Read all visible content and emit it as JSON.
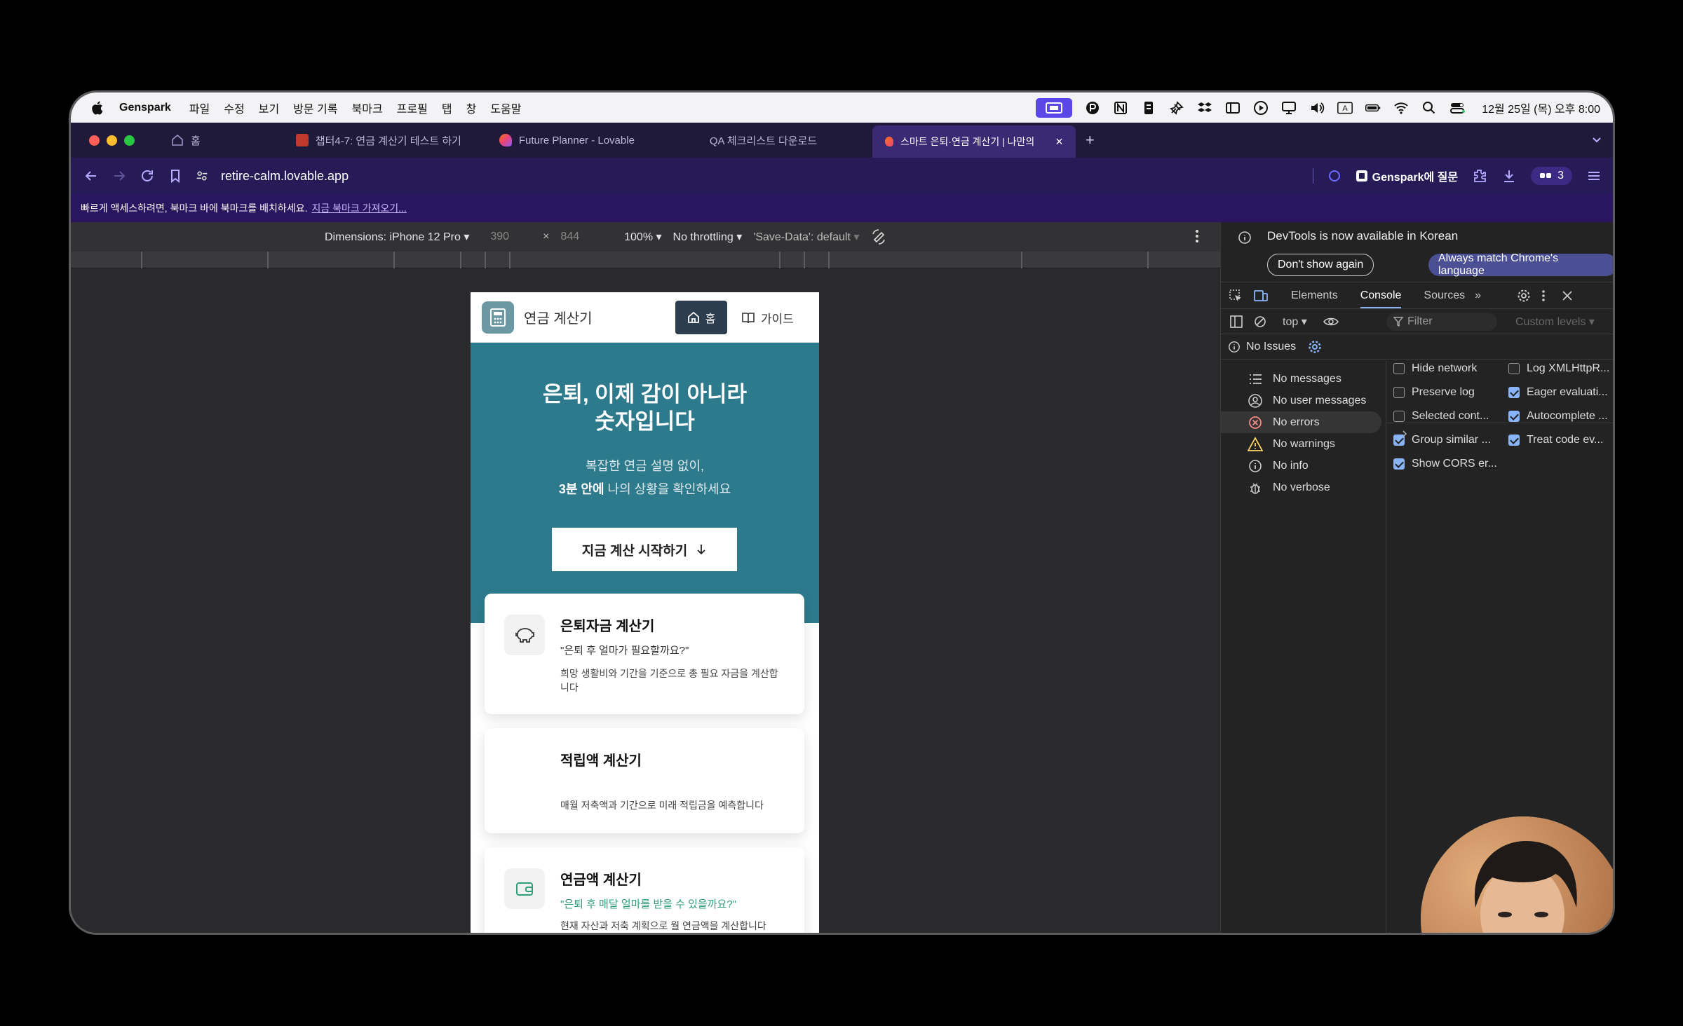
{
  "menubar": {
    "app_name": "Genspark",
    "items": [
      "파일",
      "수정",
      "보기",
      "방문 기록",
      "북마크",
      "프로필",
      "탭",
      "창",
      "도움말"
    ],
    "clock": "12월 25일 (목) 오후 8:00"
  },
  "tabs": {
    "home_label": "홈",
    "items": [
      {
        "label": "챕터4-7: 연금 계산기 테스트 하기",
        "favicon_color": "#c0392b"
      },
      {
        "label": "Future Planner - Lovable",
        "favicon_color": "#e9447a"
      },
      {
        "label": "QA 체크리스트 다운로드",
        "favicon_color": ""
      },
      {
        "label": "스마트 은퇴·연금 계산기 | 나만의",
        "favicon_color": "#e9447a"
      }
    ]
  },
  "address": {
    "url": "retire-calm.lovable.app",
    "genspark_ask": "Genspark에 질문",
    "ext_count": "3"
  },
  "bookmarks_bar": {
    "text": "빠르게 액세스하려면, 북마크 바에 북마크를 배치하세요.",
    "link": "지금 북마크 가져오기..."
  },
  "device_toolbar": {
    "dimensions": "Dimensions: iPhone 12 Pro",
    "width": "390",
    "height": "844",
    "zoom": "100%",
    "throttling": "No throttling",
    "save_data": "'Save-Data': default"
  },
  "app": {
    "title": "연금 계산기",
    "home_btn": "홈",
    "guide_btn": "가이드",
    "hero_title_1": "은퇴, 이제 감이 아니라",
    "hero_title_2": "숫자입니다",
    "hero_sub_1": "복잡한 연금 설명 없이,",
    "hero_sub_2_bold": "3분 안에",
    "hero_sub_2_rest": " 나의 상황을 확인하세요",
    "cta": "지금 계산 시작하기",
    "cards": [
      {
        "title": "은퇴자금 계산기",
        "question": "\"은퇴 후 얼마가 필요할까요?\"",
        "desc": "희망 생활비와 기간을 기준으로 총 필요 자금을 계산합니다"
      },
      {
        "title": "적립액 계산기",
        "question": "",
        "desc": "매월 저축액과 기간으로 미래 적립금을 예측합니다"
      },
      {
        "title": "연금액 계산기",
        "question": "\"은퇴 후 매달 얼마를 받을 수 있을까요?\"",
        "desc": "현재 자산과 저축 계획으로 월 연금액을 계산합니다"
      }
    ]
  },
  "devtools": {
    "notice": "DevTools is now available in Korean",
    "dont_show": "Don't show again",
    "match_lang": "Always match Chrome's language",
    "tabs": [
      "Elements",
      "Console",
      "Sources"
    ],
    "context": "top",
    "filter_placeholder": "Filter",
    "custom_levels": "Custom levels",
    "issues": "No Issues",
    "sidebar": [
      "No messages",
      "No user messages",
      "No errors",
      "No warnings",
      "No info",
      "No verbose"
    ],
    "options_left": [
      {
        "label": "Hide network",
        "checked": false
      },
      {
        "label": "Preserve log",
        "checked": false
      },
      {
        "label": "Selected cont...",
        "checked": false
      },
      {
        "label": "Group similar ...",
        "checked": true
      },
      {
        "label": "Show CORS er...",
        "checked": true
      }
    ],
    "options_right": [
      {
        "label": "Log XMLHttpR...",
        "checked": false
      },
      {
        "label": "Eager evaluati...",
        "checked": true
      },
      {
        "label": "Autocomplete ...",
        "checked": true
      },
      {
        "label": "Treat code ev...",
        "checked": true
      }
    ]
  },
  "colors": {
    "hero_teal": "#2e7a8d",
    "tabbar": "#1f1a3a",
    "accent_purple": "#5b47e8"
  }
}
